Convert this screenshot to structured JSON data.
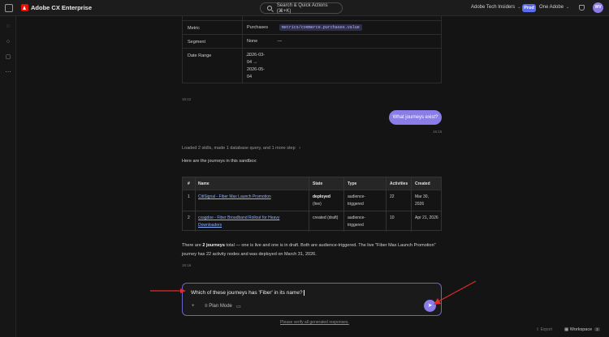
{
  "app": {
    "title": "Adobe CX Enterprise"
  },
  "topbar": {
    "search_label": "Search & Quick Actions (⌘+K)",
    "org": "Adobe Tech Insiders",
    "env_badge": "Prod",
    "product": "One Adobe",
    "avatar_initials": "WV"
  },
  "details_table": {
    "rows": [
      {
        "key": "Metric",
        "value_text": "Purchases",
        "value_code": "metrics/commerce.purchases.value"
      },
      {
        "key": "Segment",
        "value": "None",
        "value2": "—"
      },
      {
        "key": "Date Range",
        "value_lines": [
          "2026-03-",
          "04 →",
          "2026-05-",
          "04"
        ],
        "value2": "—"
      }
    ]
  },
  "timestamps": [
    "16:12",
    "16:16",
    "16:16"
  ],
  "user_message": "What journeys exist?",
  "loaded_summary": "Loaded 2 skills, made 1 database query, and 1 more step",
  "intro_text": "Here are the journeys in this sandbox:",
  "journeys_table": {
    "headers": [
      "#",
      "Name",
      "State",
      "Type",
      "Activities",
      "Created"
    ],
    "rows": [
      {
        "num": "1",
        "name": "CitiSignal - Fiber Max Launch Promotion",
        "state": "deployed",
        "state_sub": "(live)",
        "type_lines": [
          "audience-",
          "triggered"
        ],
        "activities": "22",
        "created_lines": [
          "Mar 30,",
          "2026"
        ]
      },
      {
        "num": "2",
        "name_lines": [
          "cxagdoe - Fiber Broadband Rollout for Heavy",
          "Downloaders"
        ],
        "state": "created (draft)",
        "type_lines": [
          "audience-",
          "triggered"
        ],
        "activities": "10",
        "created": "Apr 21, 2026"
      }
    ]
  },
  "summary": {
    "line1_pre": "There are ",
    "line1_bold": "2 journeys",
    "line1_post": " total — one is live and one is in draft. Both are audience-triggered. The live \"Fiber Max Launch Promotion\"",
    "line2": "journey has 22 activity nodes and was deployed on March 31, 2026."
  },
  "composer": {
    "input_value": "Which of these journeys has 'Fiber' in its name?",
    "plan_mode_label": "Plan Mode",
    "verify_text": "Please verify all generated responses."
  },
  "footer": {
    "export_label": "Export",
    "workspace_label": "Workspace",
    "workspace_count": "3"
  },
  "colors": {
    "accent": "#8a7de8",
    "prod_badge": "#5c6cf0",
    "annotation_arrow": "#e02b2b",
    "brand": "#eb1000"
  }
}
